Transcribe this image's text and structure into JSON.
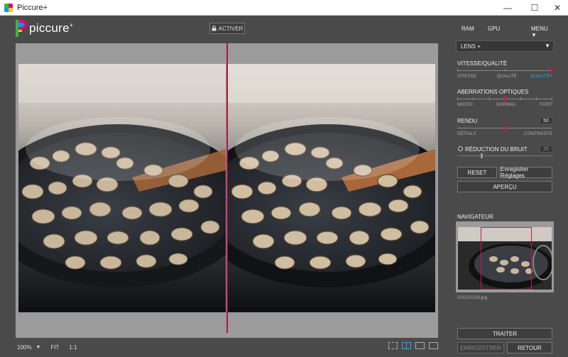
{
  "window": {
    "title": "Piccure+",
    "minimize": "—",
    "maximize": "☐",
    "close": "✕"
  },
  "logo": {
    "text": "piccure",
    "sup": "+"
  },
  "toolbar": {
    "activate_label": "ACTIVER",
    "lock_icon": "lock-icon"
  },
  "topnav": {
    "ram": "RAM",
    "gpu": "GPU",
    "menu": "MENU",
    "menu_arrow": "▼"
  },
  "lens_select": {
    "value": "LENS +",
    "arrow": "▼"
  },
  "speed_quality": {
    "label": "VITESSE/QUALITÉ",
    "scale": [
      "VITESSE",
      "QUALITÉ",
      "QUALITÉ+"
    ],
    "value_fraction": 1.0
  },
  "optical_aberrations": {
    "label": "ABERRATIONS OPTIQUES",
    "scale": [
      "MICRO",
      "NORMAL",
      "FORT"
    ],
    "value_fraction": 0.5
  },
  "render": {
    "label": "RENDU",
    "value": "50",
    "scale": [
      "DÉTAILS",
      "CONTRASTE"
    ],
    "value_fraction": 0.5
  },
  "noise_reduction": {
    "label": "RÉDUCTION DU BRUIT",
    "value": "25",
    "value_fraction": 0.25
  },
  "buttons": {
    "reset": "RESET",
    "save_settings": "Enregistrer Réglages",
    "preview": "APERÇU",
    "process": "TRAITER",
    "save": "ENREGISTRER",
    "back": "RETOUR"
  },
  "navigator": {
    "label": "NAVIGATEUR",
    "filename": "DSC02218.jpg"
  },
  "bottom_bar": {
    "zoom": "100%",
    "zoom_arrow": "▼",
    "fit": "FIT",
    "one_to_one": "1:1"
  },
  "colors": {
    "accent": "#d01256",
    "active_view": "#2ea8e0",
    "background": "#4a4a4a",
    "viewport": "#9b9b9b"
  }
}
